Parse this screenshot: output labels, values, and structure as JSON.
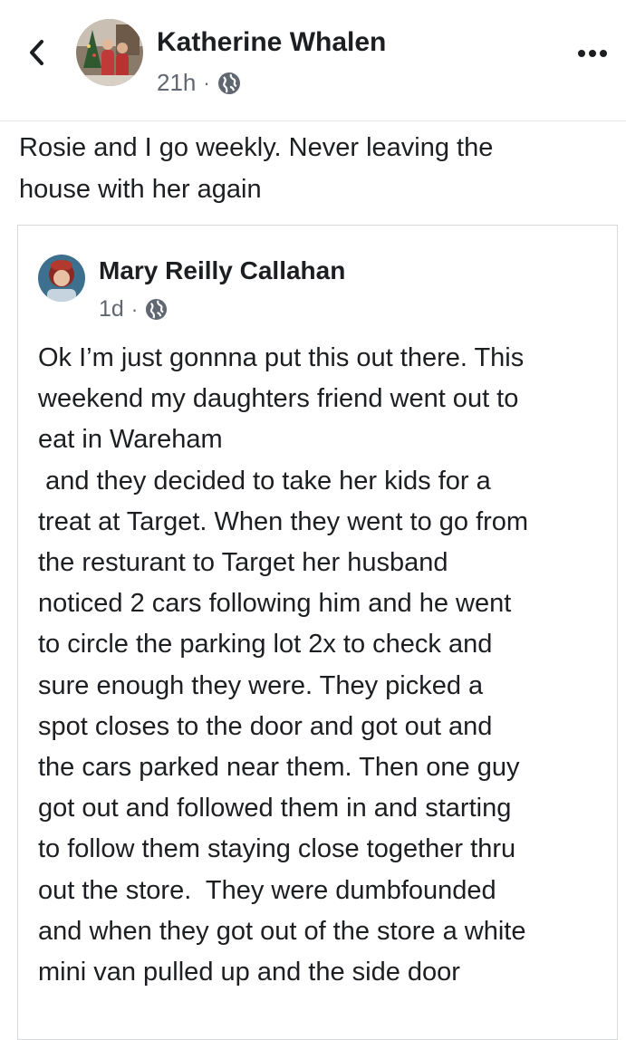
{
  "colors": {
    "text_primary": "#1c1e21",
    "text_secondary": "#606770",
    "divider": "#e4e6eb",
    "card_border": "#d6d8dc"
  },
  "header": {
    "back_icon": "chevron-left-icon",
    "author_name": "Katherine Whalen",
    "timestamp": "21h",
    "separator": "·",
    "audience_icon": "globe-icon",
    "more_icon": "more-horizontal-icon"
  },
  "post": {
    "text": "Rosie and I go weekly. Never leaving the\nhouse with her again"
  },
  "shared_post": {
    "author_name": "Mary Reilly Callahan",
    "timestamp": "1d",
    "separator": "·",
    "audience_icon": "globe-icon",
    "text": "Ok I’m just gonnna put this out there. This\nweekend my daughters friend went out to\neat in Wareham\n and they decided to take her kids for a\ntreat at Target. When they went to go from\nthe resturant to Target her husband\nnoticed 2 cars following him and he went\nto circle the parking lot 2x to check and\nsure enough they were. They picked a\nspot closes to the door and got out and\nthe cars parked near them. Then one guy\ngot out and followed them in and starting\nto follow them staying close together thru\nout the store.  They were dumbfounded\nand when they got out of the store a white\nmini van pulled up and the side door"
  }
}
